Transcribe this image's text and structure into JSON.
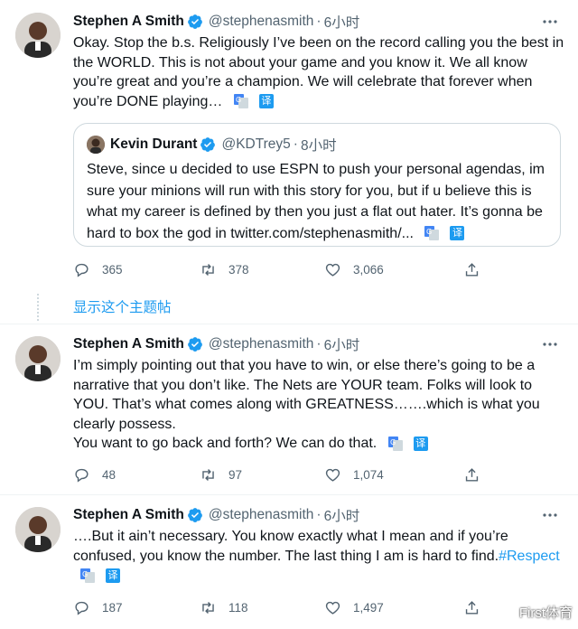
{
  "tweets": [
    {
      "name": "Stephen A Smith",
      "handle": "@stephenasmith",
      "dot": "·",
      "time": "6小时",
      "text": "Okay. Stop the b.s. Religiously I’ve been on the record calling you the best in the WORLD. This is not about your game and you know it. We all know you’re great and you’re a champion. We will celebrate that forever when you’re DONE playing…",
      "translate_label": "译",
      "quote": {
        "name": "Kevin Durant",
        "handle": "@KDTrey5",
        "dot": "·",
        "time": "8小时",
        "text": "Steve, since u decided to use ESPN to push your personal agendas, im sure your minions will run with this story for you, but if u believe this is what my career is defined by then you just a flat out hater. It’s gonna be hard to box the god in twitter.com/stephenasmith/...",
        "translate_label": "译"
      },
      "replies": "365",
      "retweets": "378",
      "likes": "3,066"
    },
    {
      "name": "Stephen A Smith",
      "handle": "@stephenasmith",
      "dot": "·",
      "time": "6小时",
      "text": "I’m simply pointing out that you have to win, or else there’s going to be a narrative that you don’t like. The Nets are YOUR team. Folks will look to YOU. That’s what comes along with GREATNESS…….which is what you clearly possess.",
      "text2": "You want to go back and forth? We can do that.",
      "translate_label": "译",
      "replies": "48",
      "retweets": "97",
      "likes": "1,074"
    },
    {
      "name": "Stephen A Smith",
      "handle": "@stephenasmith",
      "dot": "·",
      "time": "6小时",
      "text": "….But it ain’t necessary. You know exactly what I mean and if you’re confused, you know the number. The last thing I am is hard to find.",
      "hashtag": "#Respect",
      "translate_label": "译",
      "replies": "187",
      "retweets": "118",
      "likes": "1,497"
    }
  ],
  "show_thread": "显示这个主题帖",
  "watermark": "First体育",
  "colors": {
    "accent": "#1d9bf0",
    "muted": "#536471",
    "border": "#cfd9de"
  },
  "icons": [
    "more-icon",
    "verified-badge-icon",
    "google-translate-icon",
    "translate-icon",
    "reply-icon",
    "retweet-icon",
    "like-icon",
    "share-icon"
  ]
}
